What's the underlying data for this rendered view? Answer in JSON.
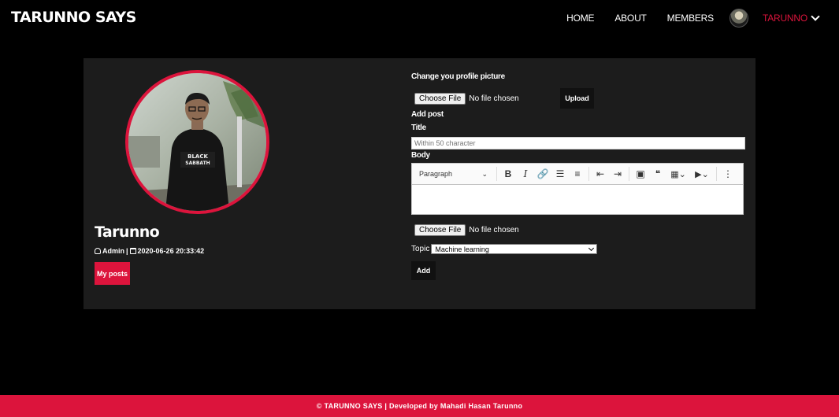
{
  "header": {
    "brand": "TARUNNO SAYS",
    "nav": [
      "HOME",
      "ABOUT",
      "MEMBERS"
    ],
    "user": "TARUNNO"
  },
  "profile": {
    "name": "Tarunno",
    "role": "Admin",
    "joined": "2020-06-26 20:33:42",
    "posts_button": "My posts"
  },
  "profile_picture": {
    "heading": "Change you profile picture",
    "file_button": "Choose File",
    "file_status": "No file chosen",
    "upload_button": "Upload"
  },
  "post_form": {
    "heading": "Add post",
    "title_label": "Title",
    "title_placeholder": "Within 50 character",
    "body_label": "Body",
    "editor_format": "Paragraph",
    "file_button": "Choose File",
    "file_status": "No file chosen",
    "topic_label": "Topic",
    "topic_value": "Machine learning",
    "add_button": "Add"
  },
  "footer": {
    "text": "© TARUNNO SAYS | Developed by Mahadi Hasan Tarunno"
  },
  "colors": {
    "accent": "#dc143c",
    "background": "#000000",
    "panel": "#1c1c1c"
  }
}
